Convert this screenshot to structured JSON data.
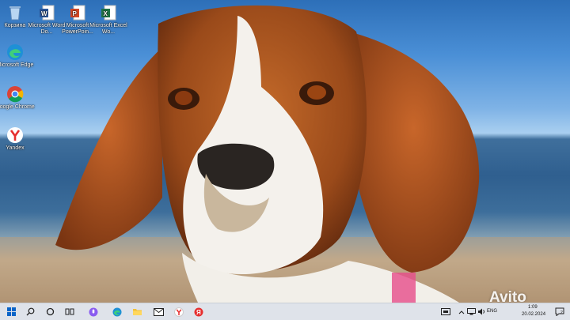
{
  "desktop_icons": [
    {
      "name": "Корзина",
      "icon": "recycle-bin-icon"
    },
    {
      "name": "Microsoft Word Do...",
      "icon": "word-icon"
    },
    {
      "name": "Microsoft PowerPoin...",
      "icon": "powerpoint-icon"
    },
    {
      "name": "Microsoft Excel Wo...",
      "icon": "excel-icon"
    },
    {
      "name": "Microsoft Edge",
      "icon": "edge-icon"
    },
    {
      "name": "Google Chrome",
      "icon": "chrome-icon"
    },
    {
      "name": "Yandex",
      "icon": "yandex-browser-icon"
    }
  ],
  "taskbar": {
    "pinned": [
      "windows-start-icon",
      "search-icon",
      "cortana-icon",
      "task-view-icon",
      "voice-assistant-icon",
      "edge-icon",
      "file-explorer-icon",
      "mail-icon",
      "yandex-browser-icon",
      "yandex-icon"
    ],
    "language": "ENG",
    "time": "1:09",
    "date": "20.02.2024",
    "notification_count": "2"
  },
  "watermark": "Avito",
  "colors": {
    "taskbar_bg": "#dfe3ea",
    "word": "#2b579a",
    "powerpoint": "#d24726",
    "excel": "#217346",
    "yandex": "#e62e2e"
  }
}
